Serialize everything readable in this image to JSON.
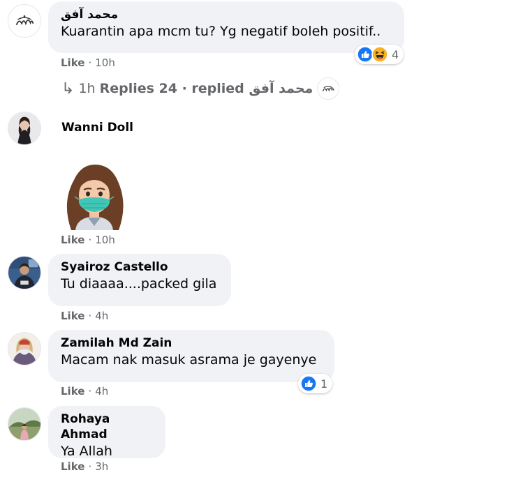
{
  "comments": [
    {
      "author": "محمد آفق",
      "text": "Kuarantin apa mcm tu? Yg negatif boleh positif..",
      "like_label": "Like",
      "time": "10h",
      "reaction_count": "4",
      "avatar_icon": "calligraphy-avatar"
    },
    {
      "author": "Wanni Doll",
      "like_label": "Like",
      "time": "10h",
      "sticker": "girl-with-mask-sticker",
      "avatar_icon": "woman-avatar"
    },
    {
      "author": "Syairoz Castello",
      "text": "Tu diaaaa....packed gila",
      "like_label": "Like",
      "time": "4h",
      "avatar_icon": "man-avatar"
    },
    {
      "author": "Zamilah Md Zain",
      "text": "Macam nak masuk asrama je gayenye",
      "like_label": "Like",
      "time": "4h",
      "reaction_count": "1",
      "avatar_icon": "masked-woman-avatar"
    },
    {
      "author": "Rohaya Ahmad",
      "text": "Ya Allah",
      "like_label": "Like",
      "time": "3h",
      "avatar_icon": "outdoor-avatar"
    }
  ],
  "replies": {
    "arrow": "↳",
    "time": "1h",
    "label": "Replies 24 · replied محمد آفق"
  },
  "dot": "·",
  "colors": {
    "like_blue": "#1877f2",
    "haha_yellow": "#f7b125",
    "bubble": "#f0f2f5",
    "meta": "#65676b"
  }
}
